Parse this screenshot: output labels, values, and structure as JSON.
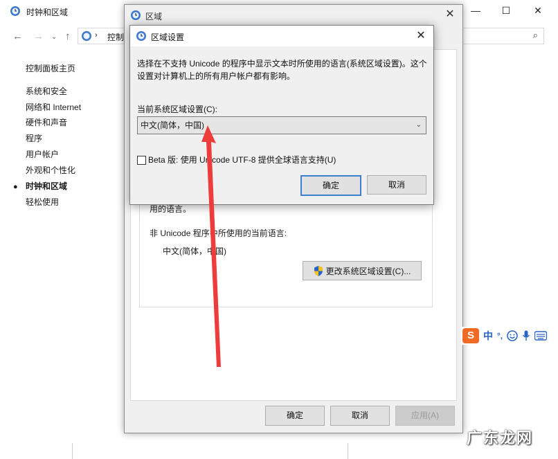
{
  "background": {
    "title": "时钟和区域",
    "address_text": "控制",
    "sidebar": {
      "home": "控制面板主页",
      "items": [
        {
          "label": "系统和安全"
        },
        {
          "label": "网络和 Internet"
        },
        {
          "label": "硬件和声音"
        },
        {
          "label": "程序"
        },
        {
          "label": "用户帐户"
        },
        {
          "label": "外观和个性化"
        },
        {
          "label": "时钟和区域"
        },
        {
          "label": "轻松使用"
        }
      ],
      "active_index": 6
    }
  },
  "region_dialog": {
    "title": "区域",
    "close_glyph": "✕",
    "partial_text": "用的语言。",
    "non_unicode_label": "非 Unicode 程序中所使用的当前语言:",
    "non_unicode_value": "中文(简体，中国)",
    "change_button": "更改系统区域设置(C)...",
    "ok": "确定",
    "cancel": "取消",
    "apply": "应用(A)"
  },
  "locale_dialog": {
    "title": "区域设置",
    "close_glyph": "✕",
    "description": "选择在不支持 Unicode 的程序中显示文本时所使用的语言(系统区域设置)。这个设置对计算机上的所有用户帐户都有影响。",
    "current_label": "当前系统区域设置(C):",
    "current_value": "中文(简体，中国)",
    "beta_label": "Beta 版: 使用 Unicode UTF-8 提供全球语言支持(U)",
    "beta_checked": false,
    "ok": "确定",
    "cancel": "取消"
  },
  "ime": {
    "logo": "S",
    "mode": "中",
    "punct": "°,",
    "icons": [
      "smiley-icon",
      "microphone-icon",
      "keyboard-icon"
    ]
  },
  "watermark": "广东龙网",
  "colors": {
    "accent": "#3c7fcf",
    "arrow": "#ee3b3b",
    "ime_orange": "#f06a26"
  }
}
